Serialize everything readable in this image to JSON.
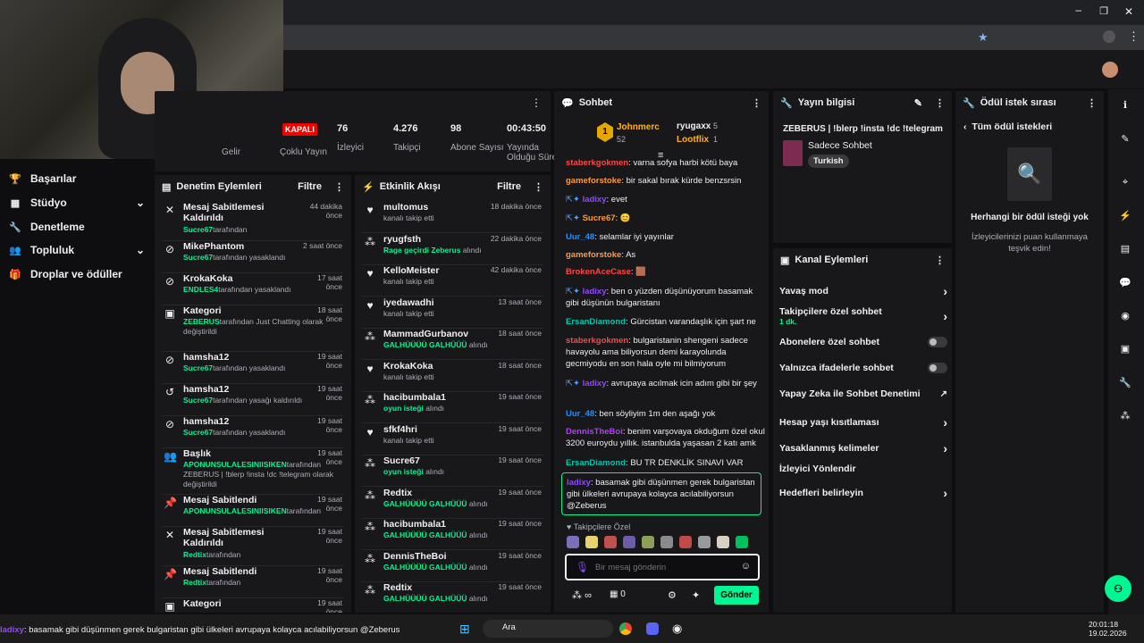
{
  "stats": [
    {
      "value": "",
      "label": "Gelir"
    },
    {
      "value": "",
      "label": "Çoklu Yayın"
    },
    {
      "value": "76",
      "label": "İzleyici"
    },
    {
      "value": "4.276",
      "label": "Takipçi"
    },
    {
      "value": "98",
      "label": "Abone Sayısı"
    },
    {
      "value": "00:43:50",
      "label": "Yayında Olduğu Süre"
    }
  ],
  "live_badge": "KAPALI",
  "sidebar": {
    "items": [
      {
        "label": "Başarılar",
        "icon": "trophy-icon"
      },
      {
        "label": "Stüdyo",
        "icon": "studio-icon",
        "chevron": "⌄"
      },
      {
        "label": "Denetleme",
        "icon": "wrench-icon"
      },
      {
        "label": "Topluluk",
        "icon": "community-icon",
        "chevron": "⌄"
      },
      {
        "label": "Droplar ve ödüller",
        "icon": "drops-icon"
      }
    ]
  },
  "mod": {
    "title": "Denetim Eylemleri",
    "filter": "Filtre",
    "rows": [
      {
        "t": "Mesaj Sabitlemesi Kaldırıldı",
        "u": "Sucre67",
        "s": "tarafından",
        "tm": "44 dakika önce"
      },
      {
        "t": "MikePhantom",
        "u": "Sucre67",
        "s": "tarafından yasaklandı",
        "tm": "2 saat önce"
      },
      {
        "t": "KrokaKoka",
        "u": "ENDLES4",
        "s": "tarafından yasaklandı",
        "tm": "17 saat önce"
      },
      {
        "t": "Kategori",
        "u": "ZEBERUS",
        "s": "tarafından Just Chatting olarak değiştirildi",
        "tm": "18 saat önce"
      },
      {
        "t": "hamsha12",
        "u": "Sucre67",
        "s": "tarafından yasaklandı",
        "tm": "19 saat önce"
      },
      {
        "t": "hamsha12",
        "u": "Sucre67",
        "s": "tarafından yasağı kaldırıldı",
        "tm": "19 saat önce"
      },
      {
        "t": "hamsha12",
        "u": "Sucre67",
        "s": "tarafından yasaklandı",
        "tm": "19 saat önce"
      },
      {
        "t": "Başlık",
        "u": "APONUNSULALESINIISIKEN",
        "s": "tarafından ZEBERUS | !blerp !insta !dc !telegram olarak değiştirildi",
        "tm": "19 saat önce"
      },
      {
        "t": "Mesaj Sabitlendi",
        "u": "APONUNSULALESINIISIKEN",
        "s": "tarafından",
        "tm": "19 saat önce"
      },
      {
        "t": "Mesaj Sabitlemesi Kaldırıldı",
        "u": "Redtix",
        "s": "tarafından",
        "tm": "19 saat önce"
      },
      {
        "t": "Mesaj Sabitlendi",
        "u": "Redtix",
        "s": "tarafından",
        "tm": "19 saat önce"
      },
      {
        "t": "Kategori",
        "u": "",
        "s": "",
        "tm": "19 saat önce"
      }
    ]
  },
  "events": {
    "title": "Etkinlik Akışı",
    "filter": "Filtre",
    "rows": [
      {
        "t": "multomus",
        "s": "kanalı takip etti",
        "tm": "18 dakika önce",
        "g": ""
      },
      {
        "t": "ryugfsth",
        "s": "alındı",
        "tm": "22 dakika önce",
        "g": "Rage geçirdi Zeberus"
      },
      {
        "t": "KelloMeister",
        "s": "kanalı takip etti",
        "tm": "42 dakika önce",
        "g": ""
      },
      {
        "t": "iyedawadhi",
        "s": "kanalı takip etti",
        "tm": "13 saat önce",
        "g": ""
      },
      {
        "t": "MammadGurbanov",
        "s": "alındı",
        "tm": "18 saat önce",
        "g": "GALHÜÜÜÜ GALHÜÜÜ"
      },
      {
        "t": "KrokaKoka",
        "s": "kanalı takip etti",
        "tm": "18 saat önce",
        "g": ""
      },
      {
        "t": "hacibumbala1",
        "s": "alındı",
        "tm": "19 saat önce",
        "g": "oyun isteği"
      },
      {
        "t": "sfkf4hri",
        "s": "kanalı takip etti",
        "tm": "19 saat önce",
        "g": ""
      },
      {
        "t": "Sucre67",
        "s": "alındı",
        "tm": "19 saat önce",
        "g": "oyun isteği"
      },
      {
        "t": "Redtix",
        "s": "alındı",
        "tm": "19 saat önce",
        "g": "GALHÜÜÜÜ GALHÜÜÜ"
      },
      {
        "t": "hacibumbala1",
        "s": "alındı",
        "tm": "19 saat önce",
        "g": "GALHÜÜÜÜ GALHÜÜÜ"
      },
      {
        "t": "DennisTheBoi",
        "s": "alındı",
        "tm": "19 saat önce",
        "g": "GALHÜÜÜÜ GALHÜÜÜ"
      },
      {
        "t": "Redtix",
        "s": "alındı",
        "tm": "19 saat önce",
        "g": "GALHÜÜÜÜ GALHÜÜÜ"
      }
    ]
  },
  "chat": {
    "title": "Sohbet",
    "leader": {
      "rank": "1",
      "name": "Johnmerc",
      "pts": "52",
      "second": "ryugaxx",
      "second_n": "5",
      "third": "Lootflix",
      "third_n": "1"
    },
    "messages": [
      {
        "u": "staberkgokmen",
        "c": "#ff4545",
        "m": "varna sofya harbi kötü baya"
      },
      {
        "u": "gameforstoke",
        "c": "#ff9a3c",
        "m": "bir sakal bırak kürde benzsrsin"
      },
      {
        "u": "ladixy",
        "c": "#9147ff",
        "m": "evet"
      },
      {
        "u": "Sucre67",
        "c": "#ff9a3c",
        "m": "😊"
      },
      {
        "u": "Uur_48",
        "c": "#1e90ff",
        "m": "selamlar iyi yayınlar"
      },
      {
        "u": "gameforstoke",
        "c": "#ff9a3c",
        "m": "As"
      },
      {
        "u": "BrokenAceCase",
        "c": "#ff4545",
        "m": "🟫"
      },
      {
        "u": "ladixy",
        "c": "#9147ff",
        "m": "ben o yüzden düşünüyorum basamak gibi düşünün bulgaristanı"
      },
      {
        "u": "ErsanDiamond",
        "c": "#00c8af",
        "m": "Gürcistan varandaşlık için şart ne"
      },
      {
        "u": "staberkgokmen",
        "c": "#ff4545",
        "m": "bulgaristanin shengeni sadece havayolu ama biliyorsun demi karayolunda gecmiyodu en son hala oyle mi bilmiyorum"
      },
      {
        "u": "ladixy",
        "c": "#9147ff",
        "m": "avrupaya acılmak icin adım gibi bir şey"
      },
      {
        "u": "Uur_48",
        "c": "#1e90ff",
        "m": "ben söyliyim 1m den aşağı yok"
      },
      {
        "u": "DennisTheBoi",
        "c": "#b43cff",
        "m": "benim varşovaya okduğum özel okul 3200 euroydu yıllık. istanbulda yaşasan 2 katı amk"
      },
      {
        "u": "ErsanDiamond",
        "c": "#00c8af",
        "m": "BU TR DENKLİK SINAVI VAR"
      }
    ],
    "highlight": {
      "u": "ladixy",
      "m": "basamak gibi düşünmen gerek bulgaristan gibi ülkeleri avrupaya kolayca acılabiliyorsun @Zeberus"
    },
    "followers_only": "Takipçilere Özel",
    "placeholder": "Bir mesaj gönderin",
    "points": "∞",
    "chest": "0",
    "send": "Gönder"
  },
  "stream": {
    "title": "Yayın bilgisi",
    "stream_title": "ZEBERUS | !blerp !insta !dc !telegram",
    "category": "Sadece Sohbet",
    "tag": "Turkish"
  },
  "rewards": {
    "title": "Ödül istek sırası",
    "all": "Tüm ödül istekleri",
    "empty": "Herhangi bir ödül isteği yok",
    "hint": "İzleyicilerinizi puan kullanmaya teşvik edin!"
  },
  "channel": {
    "title": "Kanal Eylemleri",
    "rows": [
      {
        "label": "Yavaş mod",
        "sub": "",
        "kind": "arrow"
      },
      {
        "label": "Takipçilere özel sohbet",
        "sub": "1 dk.",
        "kind": "arrow"
      },
      {
        "label": "Abonelere özel sohbet",
        "sub": "",
        "kind": "toggle"
      },
      {
        "label": "Yalnızca ifadelerle sohbet",
        "sub": "",
        "kind": "toggle"
      },
      {
        "label": "Yapay Zeka ile Sohbet Denetimi",
        "sub": "",
        "kind": "ext"
      },
      {
        "label": "Hesap yaşı kısıtlaması",
        "sub": "",
        "kind": "arrow"
      },
      {
        "label": "Yasaklanmış kelimeler",
        "sub": "",
        "kind": "arrow"
      },
      {
        "label": "İzleyici Yönlendir",
        "sub": "",
        "kind": "none"
      },
      {
        "label": "Hedefleri belirleyin",
        "sub": "",
        "kind": "arrow"
      }
    ]
  },
  "ticker": {
    "u": "ladixy",
    "m": ": basamak gibi düşünmen gerek bulgaristan gibi ülkeleri avrupaya kolayca acılabiliyorsun @Zeberus"
  },
  "taskbar": {
    "search": "Ara",
    "time": "20:01:18",
    "date": "19.02.2026"
  },
  "colors": {
    "accent": "#00f593",
    "panel": "#18181b",
    "bg": "#0e0e10"
  }
}
